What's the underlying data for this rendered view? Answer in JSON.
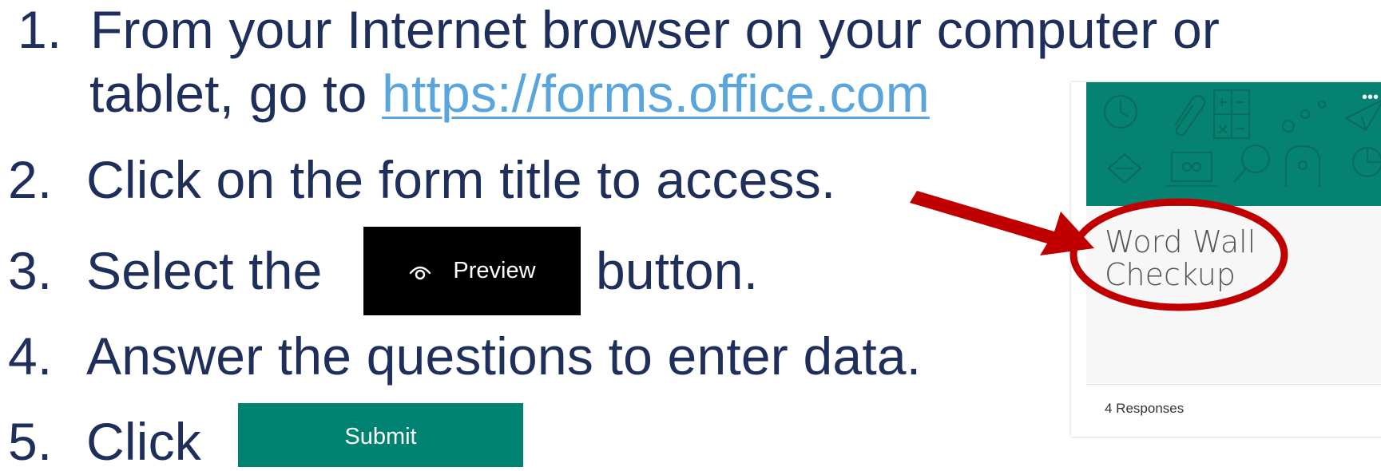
{
  "steps": {
    "s1_num": "1.",
    "s1_text_a": "From your Internet browser on your computer or",
    "s1_text_b": "tablet, go to ",
    "s1_link": "https://forms.office.com",
    "s2_num": "2.",
    "s2_text": "Click on the form title to access.",
    "s3_num": "3.",
    "s3_text_a": "Select the",
    "s3_text_b": "button.",
    "s4_num": "4.",
    "s4_text": "Answer the questions to enter data.",
    "s5_num": "5.",
    "s5_text": "Click"
  },
  "preview_button": {
    "label": "Preview",
    "icon": "eye-icon"
  },
  "submit_button": {
    "label": "Submit"
  },
  "form_card": {
    "title": "Word Wall Checkup",
    "responses": "4 Responses",
    "more_icon": "ellipsis-icon",
    "header_color": "#058272"
  },
  "colors": {
    "text": "#1f2f5c",
    "link": "#5aa6dc",
    "annotation": "#c00000",
    "submit": "#008272",
    "preview": "#000000"
  }
}
